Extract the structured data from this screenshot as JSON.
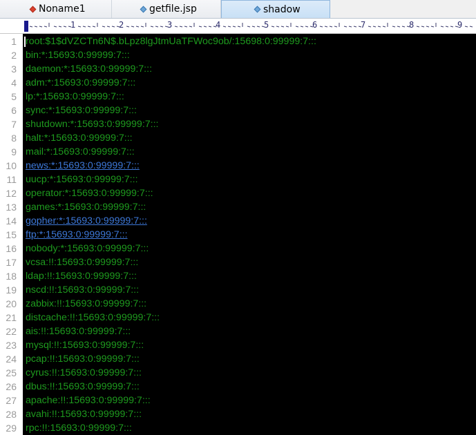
{
  "tabs": [
    {
      "label": "Noname1",
      "icon": "red-diamond-icon",
      "active": false
    },
    {
      "label": "getfile.jsp",
      "icon": "blue-diamond-icon",
      "active": false
    },
    {
      "label": "shadow",
      "icon": "blue-diamond-icon",
      "active": true
    }
  ],
  "ruler": {
    "numbers": [
      "1",
      "2",
      "3",
      "4",
      "5",
      "6",
      "7",
      "8",
      "9"
    ]
  },
  "lines": [
    {
      "n": "1",
      "text": "root:$1$dVZCTn6N$.bLpz8lgJtmUaTFWoc9ob/:15698:0:99999:7:::",
      "link": false
    },
    {
      "n": "2",
      "text": "bin:*:15693:0:99999:7:::",
      "link": false
    },
    {
      "n": "3",
      "text": "daemon:*:15693:0:99999:7:::",
      "link": false
    },
    {
      "n": "4",
      "text": "adm:*:15693:0:99999:7:::",
      "link": false
    },
    {
      "n": "5",
      "text": "lp:*:15693:0:99999:7:::",
      "link": false
    },
    {
      "n": "6",
      "text": "sync:*:15693:0:99999:7:::",
      "link": false
    },
    {
      "n": "7",
      "text": "shutdown:*:15693:0:99999:7:::",
      "link": false
    },
    {
      "n": "8",
      "text": "halt:*:15693:0:99999:7:::",
      "link": false
    },
    {
      "n": "9",
      "text": "mail:*:15693:0:99999:7:::",
      "link": false
    },
    {
      "n": "10",
      "text": "news:*:15693:0:99999:7:::",
      "link": true
    },
    {
      "n": "11",
      "text": "uucp:*:15693:0:99999:7:::",
      "link": false
    },
    {
      "n": "12",
      "text": "operator:*:15693:0:99999:7:::",
      "link": false
    },
    {
      "n": "13",
      "text": "games:*:15693:0:99999:7:::",
      "link": false
    },
    {
      "n": "14",
      "text": "gopher:*:15693:0:99999:7:::",
      "link": true
    },
    {
      "n": "15",
      "text": "ftp:*:15693:0:99999:7:::",
      "link": true
    },
    {
      "n": "16",
      "text": "nobody:*:15693:0:99999:7:::",
      "link": false
    },
    {
      "n": "17",
      "text": "vcsa:!!:15693:0:99999:7:::",
      "link": false
    },
    {
      "n": "18",
      "text": "ldap:!!:15693:0:99999:7:::",
      "link": false
    },
    {
      "n": "19",
      "text": "nscd:!!:15693:0:99999:7:::",
      "link": false
    },
    {
      "n": "20",
      "text": "zabbix:!!:15693:0:99999:7:::",
      "link": false
    },
    {
      "n": "21",
      "text": "distcache:!!:15693:0:99999:7:::",
      "link": false
    },
    {
      "n": "22",
      "text": "ais:!!:15693:0:99999:7:::",
      "link": false
    },
    {
      "n": "23",
      "text": "mysql:!!:15693:0:99999:7:::",
      "link": false
    },
    {
      "n": "24",
      "text": "pcap:!!:15693:0:99999:7:::",
      "link": false
    },
    {
      "n": "25",
      "text": "cyrus:!!:15693:0:99999:7:::",
      "link": false
    },
    {
      "n": "26",
      "text": "dbus:!!:15693:0:99999:7:::",
      "link": false
    },
    {
      "n": "27",
      "text": "apache:!!:15693:0:99999:7:::",
      "link": false
    },
    {
      "n": "28",
      "text": "avahi:!!:15693:0:99999:7:::",
      "link": false
    },
    {
      "n": "29",
      "text": "rpc:!!:15693:0:99999:7:::",
      "link": false
    }
  ],
  "colors": {
    "editor_bg": "#000000",
    "text": "#1e9a1e",
    "link": "#3d78d8",
    "line_number": "#9a9a9a"
  }
}
